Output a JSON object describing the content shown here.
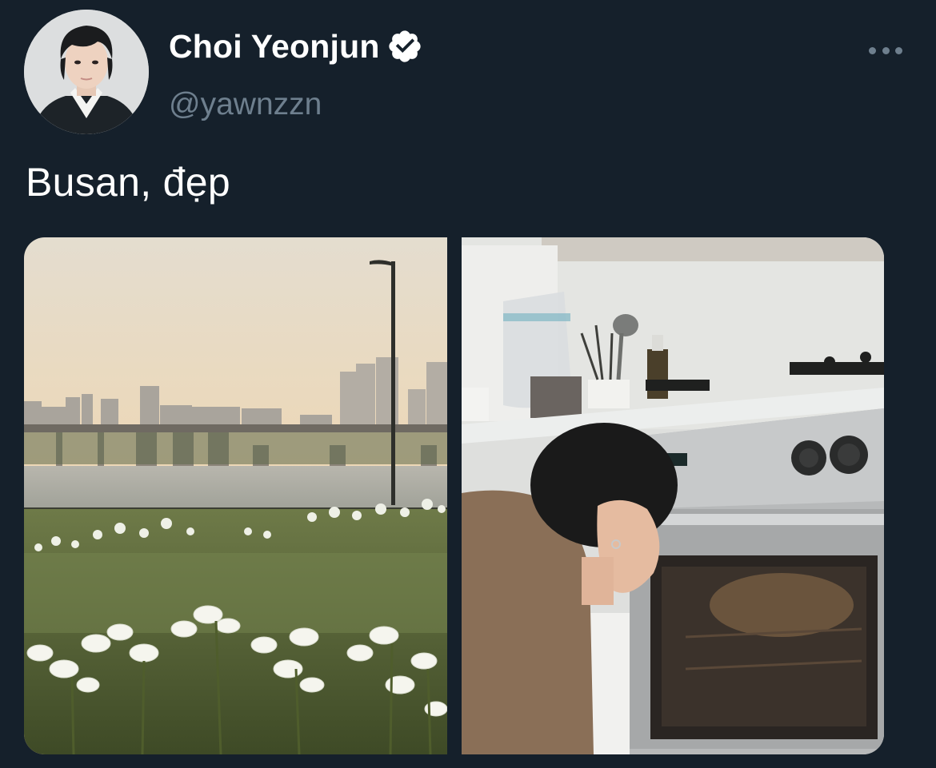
{
  "tweet": {
    "author": {
      "display_name": "Choi Yeonjun",
      "handle": "@yawnzzn",
      "verified": true,
      "avatar_icon": "profile-photo"
    },
    "text": "Busan, đẹp",
    "more_icon": "more-dots-icon",
    "media": [
      {
        "icon": "photo-river-lilies"
      },
      {
        "icon": "photo-kitchen-oven"
      }
    ]
  },
  "colors": {
    "background": "#15202b",
    "text_primary": "#ffffff",
    "text_secondary": "#6e7f8e"
  }
}
